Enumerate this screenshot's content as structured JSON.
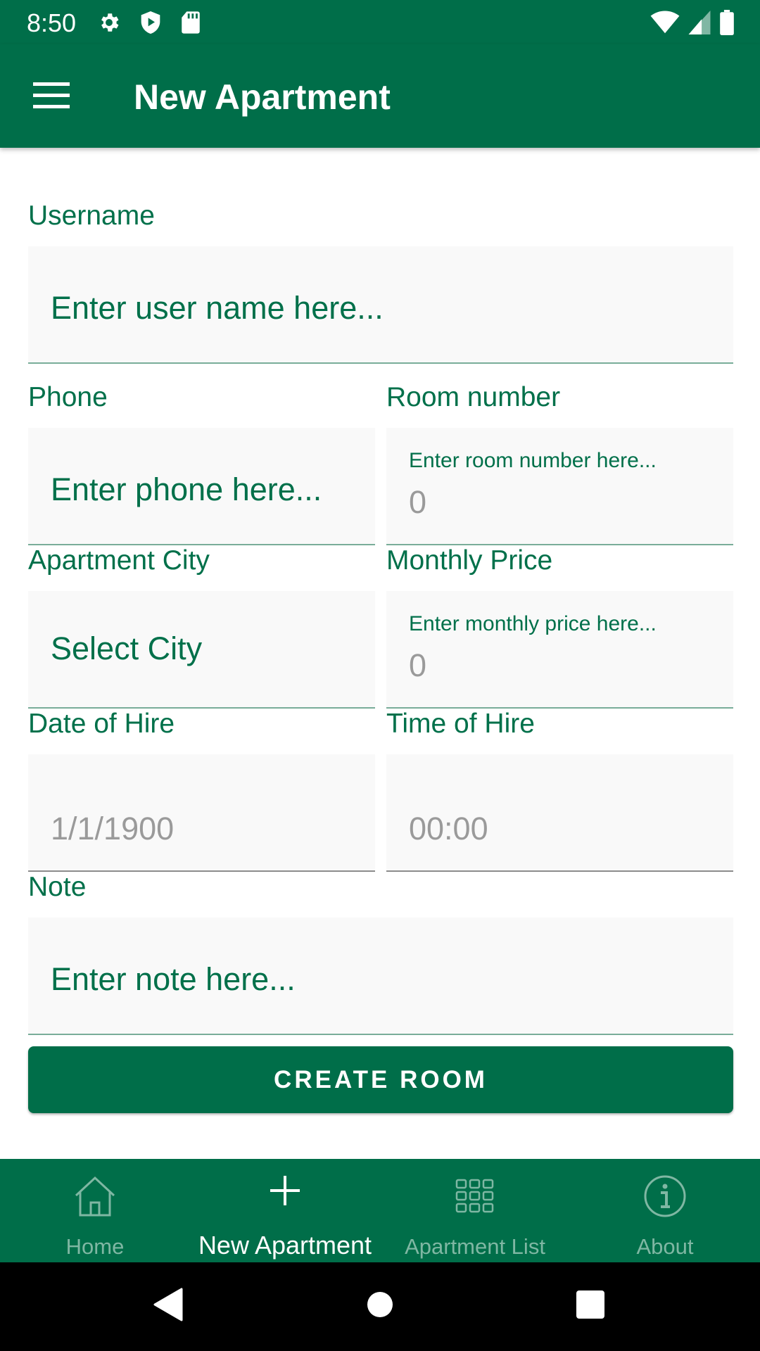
{
  "status_bar": {
    "time": "8:50",
    "left_icons": [
      "gear-icon",
      "shield-play-icon",
      "sd-card-icon"
    ],
    "right_icons": [
      "wifi-icon",
      "signal-icon",
      "battery-icon"
    ]
  },
  "app_bar": {
    "title": "New Apartment",
    "menu_icon": "hamburger-menu-icon"
  },
  "form": {
    "username": {
      "label": "Username",
      "placeholder": "Enter user name here..."
    },
    "phone": {
      "label": "Phone",
      "placeholder": "Enter phone here..."
    },
    "room_number": {
      "label": "Room number",
      "hint": "Enter room number here...",
      "value": "0"
    },
    "apartment_city": {
      "label": "Apartment City",
      "selected": "Select City"
    },
    "monthly_price": {
      "label": "Monthly Price",
      "hint": "Enter monthly price here...",
      "value": "0"
    },
    "date_of_hire": {
      "label": "Date of Hire",
      "value": "1/1/1900"
    },
    "time_of_hire": {
      "label": "Time of Hire",
      "value": "00:00"
    },
    "note": {
      "label": "Note",
      "placeholder": "Enter note here..."
    },
    "submit_label": "CREATE ROOM"
  },
  "bottom_nav": {
    "items": [
      {
        "label": "Home",
        "icon": "home-icon",
        "active": false
      },
      {
        "label": "New Apartment",
        "icon": "plus-icon",
        "active": true
      },
      {
        "label": "Apartment List",
        "icon": "grid-icon",
        "active": false
      },
      {
        "label": "About",
        "icon": "info-icon",
        "active": false
      }
    ]
  },
  "colors": {
    "primary": "#006e49",
    "label": "#00704a",
    "inactive_nav": "#7fb7a3"
  }
}
